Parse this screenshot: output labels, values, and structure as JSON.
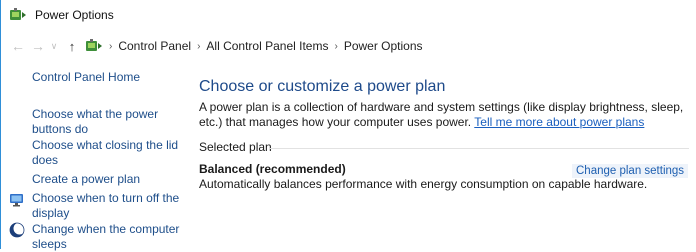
{
  "window": {
    "title": "Power Options"
  },
  "address": {
    "crumbs": [
      "Control Panel",
      "All Control Panel Items",
      "Power Options"
    ],
    "separator": "›"
  },
  "sidebar": {
    "home": "Control Panel Home",
    "links": [
      {
        "label": "Choose what the power buttons do",
        "icon": null
      },
      {
        "label": "Choose what closing the lid does",
        "icon": null
      },
      {
        "label": "Create a power plan",
        "icon": null
      },
      {
        "label": "Choose when to turn off the display",
        "icon": "monitor-icon"
      },
      {
        "label": "Change when the computer sleeps",
        "icon": "moon-icon"
      }
    ]
  },
  "main": {
    "heading": "Choose or customize a power plan",
    "intro": "A power plan is a collection of hardware and system settings (like display brightness, sleep, etc.) that manages how your computer uses power.",
    "intro_link": "Tell me more about power plans",
    "selected_label": "Selected plan",
    "plan": {
      "name": "Balanced (recommended)",
      "description": "Automatically balances performance with energy consumption on capable hardware.",
      "change_label": "Change plan settings"
    }
  },
  "colors": {
    "link": "#1e4e8a",
    "heading": "#1e4a8a",
    "frame": "#2f8fd8"
  }
}
